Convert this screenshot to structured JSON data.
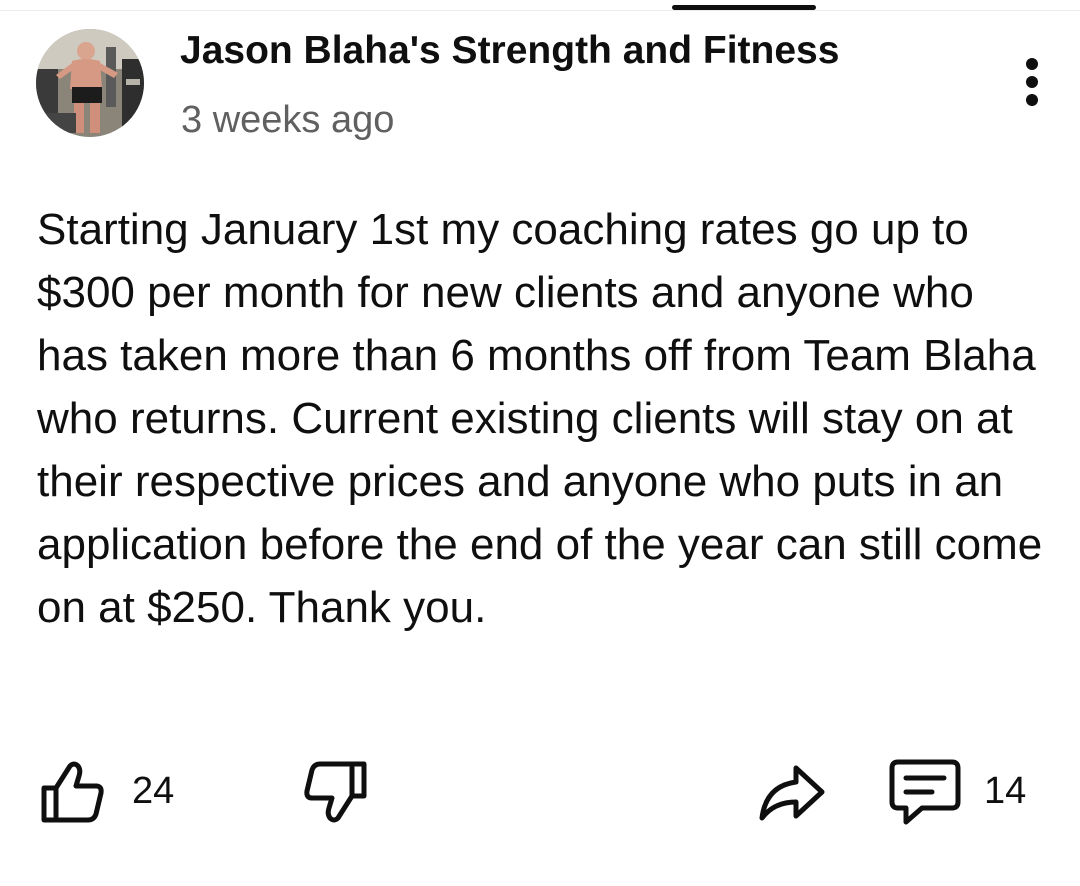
{
  "post": {
    "channel_name": "Jason Blaha's Strength and Fitness",
    "time_ago": "3 weeks ago",
    "body": "Starting January 1st my coaching rates go up to $300 per month for new clients and anyone who has taken more than 6 months off from Team Blaha who returns. Current existing clients will stay on at their respective prices and anyone who puts in an application before the end of the year can still come on at $250. Thank you."
  },
  "actions": {
    "like_count": "24",
    "comment_count": "14",
    "icons": {
      "like": "thumbs-up-icon",
      "dislike": "thumbs-down-icon",
      "share": "share-icon",
      "comment": "comment-icon",
      "menu": "more-vertical-icon"
    }
  },
  "colors": {
    "text_primary": "#0f0f0f",
    "text_secondary": "#606060",
    "background": "#ffffff"
  }
}
